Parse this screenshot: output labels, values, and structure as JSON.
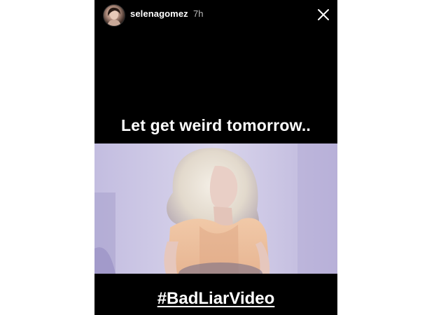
{
  "story": {
    "username": "selenagomez",
    "timestamp": "7h",
    "caption_top": "Let get weird tomorrow..",
    "caption_bottom": "#BadLiarVideo"
  },
  "icons": {
    "avatar": "profile-avatar",
    "close": "close-icon"
  },
  "colors": {
    "background": "#000000",
    "text": "#ffffff",
    "timestamp": "#b9b9b9"
  }
}
